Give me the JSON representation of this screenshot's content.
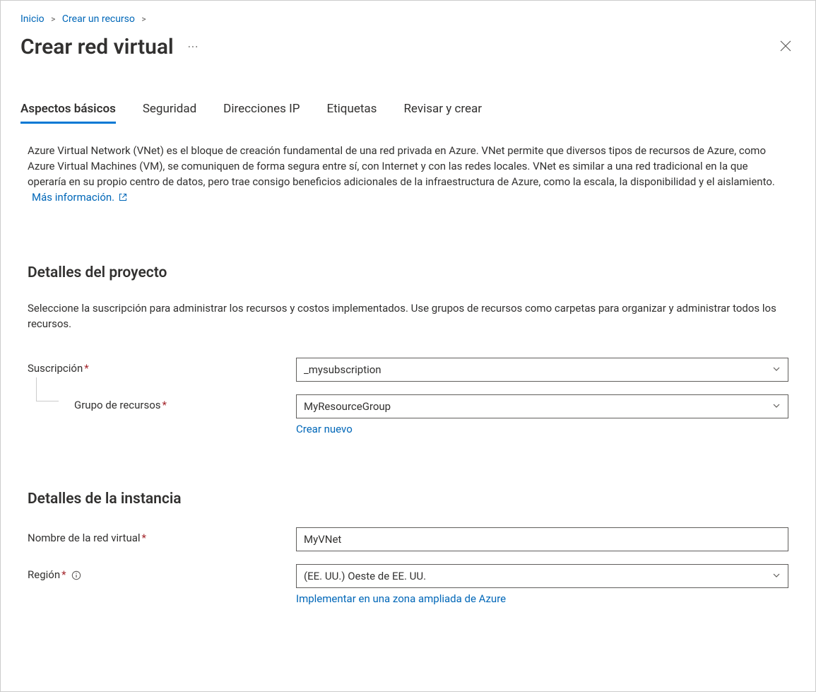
{
  "breadcrumbs": {
    "items": [
      {
        "label": "Inicio"
      },
      {
        "label": "Crear un recurso"
      }
    ]
  },
  "header": {
    "title": "Crear red virtual"
  },
  "tabs": [
    {
      "label": "Aspectos básicos",
      "active": true
    },
    {
      "label": "Seguridad",
      "active": false
    },
    {
      "label": "Direcciones IP",
      "active": false
    },
    {
      "label": "Etiquetas",
      "active": false
    },
    {
      "label": "Revisar y crear",
      "active": false
    }
  ],
  "intro": {
    "description": "Azure Virtual Network (VNet) es el bloque de creación fundamental de una red privada en Azure. VNet permite que diversos tipos de recursos de Azure, como Azure Virtual Machines (VM), se comuniquen de forma segura entre sí, con Internet y con las redes locales. VNet es similar a una red tradicional en la que operaría en su propio centro de datos, pero trae consigo beneficios adicionales de la infraestructura de Azure, como la escala, la disponibilidad y el aislamiento.",
    "learn_more": "Más información."
  },
  "project_details": {
    "heading": "Detalles del proyecto",
    "description": "Seleccione la suscripción para administrar los recursos y costos implementados. Use grupos de recursos como carpetas para organizar y administrar todos los recursos.",
    "subscription": {
      "label": "Suscripción",
      "value": "_mysubscription"
    },
    "resource_group": {
      "label": "Grupo de recursos",
      "value": "MyResourceGroup",
      "create_new": "Crear nuevo"
    }
  },
  "instance_details": {
    "heading": "Detalles de la instancia",
    "vnet_name": {
      "label": "Nombre de la red virtual",
      "value": "MyVNet"
    },
    "region": {
      "label": "Región",
      "value": "(EE. UU.) Oeste de EE. UU.",
      "extended_zone_link": "Implementar en una zona ampliada de Azure"
    }
  }
}
